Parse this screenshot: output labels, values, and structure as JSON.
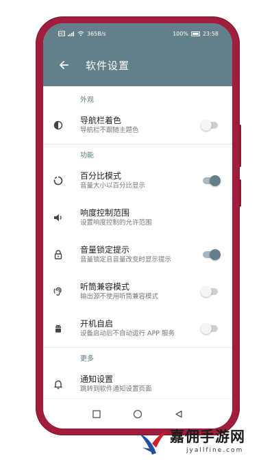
{
  "status_bar": {
    "left": "365B/s",
    "battery": "100%",
    "time": "23:58"
  },
  "app_bar": {
    "title": "软件设置"
  },
  "sections": {
    "appearance": {
      "header": "外观",
      "nav_color": {
        "title": "导航栏着色",
        "subtitle": "导航栏不跟随主题色",
        "enabled": false,
        "icon": "contrast-icon"
      }
    },
    "features": {
      "header": "功能",
      "percent_mode": {
        "title": "百分比模式",
        "subtitle": "音量大小以百分比显示",
        "enabled": true,
        "icon": "circle-loading-icon"
      },
      "loudness_range": {
        "title": "响度控制范围",
        "subtitle": "设置响度控制的允许范围",
        "icon": "speaker-icon"
      },
      "volume_lock": {
        "title": "音量锁定提示",
        "subtitle": "音量锁定且音量改变时显示提示",
        "enabled": true,
        "icon": "lock-icon"
      },
      "earpiece_compat": {
        "title": "听筒兼容模式",
        "subtitle": "输出源不使用听筒兼容模式",
        "enabled": false,
        "icon": "ear-icon"
      },
      "auto_start": {
        "title": "开机自启",
        "subtitle": "设备启动后不自动运行 APP 服务",
        "enabled": false,
        "icon": "android-icon"
      }
    },
    "more": {
      "header": "更多",
      "notifications": {
        "title": "通知设置",
        "subtitle": "跳转到软件通知设置页面",
        "icon": "bell-icon"
      }
    }
  },
  "colors": {
    "primary": "#647f8c",
    "phone_frame": "#a01d3b",
    "toggle_on_track": "#a9b8c0"
  },
  "watermark": {
    "text": "嘉佣手游网",
    "url": "jyallfine.com"
  }
}
